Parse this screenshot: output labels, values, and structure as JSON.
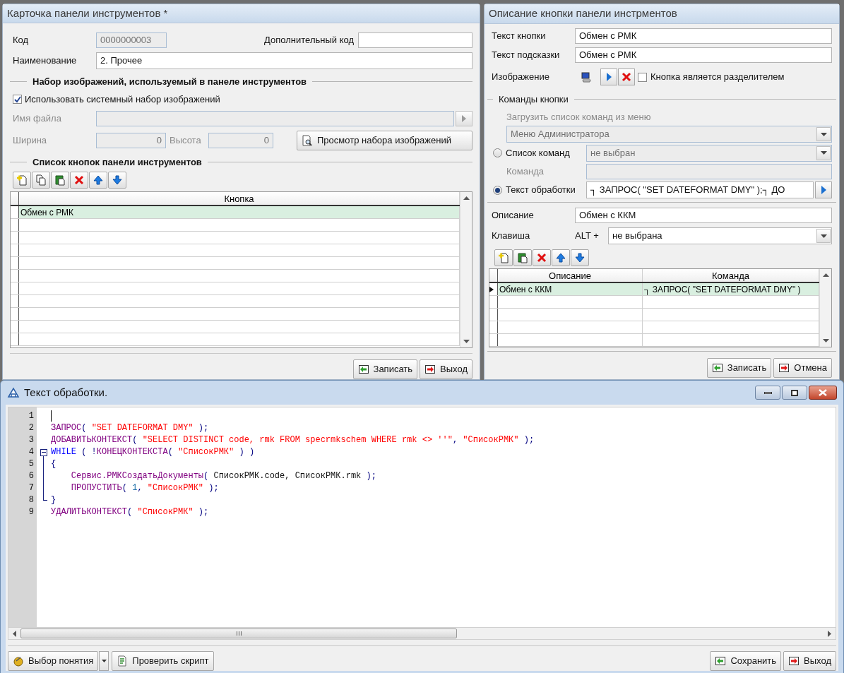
{
  "card": {
    "title": "Карточка панели инструментов *",
    "code": {
      "label": "Код",
      "value": "0000000003",
      "disabled": true
    },
    "extra_code": {
      "label": "Дополнительный код"
    },
    "name": {
      "label": "Наименование",
      "value": "2. Прочее"
    },
    "images": {
      "title": "Набор изображений, используемый в панеле инструментов",
      "use_system": {
        "label": "Использовать системный набор изображений",
        "checked": true
      },
      "file": {
        "label": "Имя файла",
        "disabled": true
      },
      "width": {
        "label": "Ширина",
        "value": "0",
        "disabled": true
      },
      "height": {
        "label": "Высота",
        "value": "0",
        "disabled": true
      },
      "preview": "Просмотр набора изображений"
    },
    "buttons_list": {
      "title": "Список кнопок панели инструментов",
      "table": {
        "columns": [
          "Кнопка"
        ],
        "rows": [
          {
            "cells": [
              "Обмен с РМК"
            ],
            "selected": true
          }
        ]
      }
    },
    "actions": [
      {
        "label": "Записать",
        "kind": "save"
      },
      {
        "label": "Выход",
        "kind": "exit"
      }
    ]
  },
  "button_card": {
    "title": "Описание кнопки панели инстрментов",
    "caption": {
      "label": "Текст кнопки",
      "value": "Обмен с РМК"
    },
    "tooltip": {
      "label": "Текст подсказки",
      "value": "Обмен с РМК"
    },
    "image": {
      "label": "Изображение"
    },
    "separator": {
      "label": "Кнопка является разделителем",
      "checked": false
    },
    "commands": {
      "title": "Команды кнопки",
      "menu_source": {
        "label": "Загрузить список команд из меню",
        "value": "Меню Администратора",
        "disabled": true
      },
      "command_list": {
        "label": "Список команд",
        "selected": false,
        "value": "не выбран",
        "disabled": true
      },
      "command": {
        "label": "Команда",
        "disabled": true
      },
      "script": {
        "label": "Текст обработки",
        "selected": true,
        "value": "┐ ЗАПРОС( \"SET DATEFORMAT DMY\" );┐ ДО"
      }
    },
    "description": {
      "label": "Описание",
      "value": "Обмен с ККМ"
    },
    "hotkey": {
      "label": "Клавиша",
      "modifier": "ALT +",
      "value": "не выбрана"
    },
    "table": {
      "columns": [
        "Описание",
        "Команда"
      ],
      "rows": [
        {
          "cells": [
            "Обмен с ККМ",
            "┐ ЗАПРОС( \"SET DATEFORMAT DMY\" )"
          ],
          "selected": true
        }
      ]
    },
    "actions": [
      {
        "label": "Записать",
        "kind": "save"
      },
      {
        "label": "Отмена",
        "kind": "exit"
      }
    ]
  },
  "script_window": {
    "title": "Текст обработки.",
    "lines": [
      {
        "number": "1",
        "kind": "line",
        "cursor": true
      },
      {
        "number": "2",
        "kind": "line",
        "segments": [
          {
            "kind": "function",
            "text": "ЗАПРОС"
          },
          {
            "kind": "punct",
            "text": "( "
          },
          {
            "kind": "string",
            "text": "\"SET DATEFORMAT DMY\""
          },
          {
            "kind": "punct",
            "text": " );"
          }
        ]
      },
      {
        "number": "3",
        "kind": "line",
        "segments": [
          {
            "kind": "function",
            "text": "ДОБАВИТЬКОНТЕКСТ"
          },
          {
            "kind": "punct",
            "text": "( "
          },
          {
            "kind": "string",
            "text": "\"SELECT DISTINCT code, rmk FROM specrmkschem WHERE rmk <> ''\""
          },
          {
            "kind": "punct",
            "text": ", "
          },
          {
            "kind": "string",
            "text": "\"СписокРМК\""
          },
          {
            "kind": "punct",
            "text": " );"
          }
        ]
      },
      {
        "number": "4",
        "kind": "fold_start",
        "segments": [
          {
            "kind": "keyword",
            "text": "WHILE"
          },
          {
            "kind": "punct",
            "text": " ( !"
          },
          {
            "kind": "function",
            "text": "КОНЕЦКОНТЕКСТА"
          },
          {
            "kind": "punct",
            "text": "( "
          },
          {
            "kind": "string",
            "text": "\"СписокРМК\""
          },
          {
            "kind": "punct",
            "text": " ) )"
          }
        ]
      },
      {
        "number": "5",
        "kind": "fold_body",
        "segments": [
          {
            "kind": "punct",
            "text": "{"
          }
        ]
      },
      {
        "number": "6",
        "kind": "fold_body",
        "segments": [
          {
            "kind": "function",
            "text": "    Сервис.РМКСоздатьДокументы"
          },
          {
            "kind": "punct",
            "text": "( "
          },
          {
            "kind": "plain",
            "text": "СписокРМК.code, СписокРМК.rmk"
          },
          {
            "kind": "punct",
            "text": " );"
          }
        ]
      },
      {
        "number": "7",
        "kind": "fold_body",
        "segments": [
          {
            "kind": "function",
            "text": "    ПРОПУСТИТЬ"
          },
          {
            "kind": "punct",
            "text": "( "
          },
          {
            "kind": "number",
            "text": "1"
          },
          {
            "kind": "punct",
            "text": ", "
          },
          {
            "kind": "string",
            "text": "\"СписокРМК\""
          },
          {
            "kind": "punct",
            "text": " );"
          }
        ]
      },
      {
        "number": "8",
        "kind": "fold_end",
        "segments": [
          {
            "kind": "punct",
            "text": "}"
          }
        ]
      },
      {
        "number": "9",
        "kind": "line",
        "segments": [
          {
            "kind": "function",
            "text": "УДАЛИТЬКОНТЕКСТ"
          },
          {
            "kind": "punct",
            "text": "( "
          },
          {
            "kind": "string",
            "text": "\"СписокРМК\""
          },
          {
            "kind": "punct",
            "text": " );"
          }
        ]
      }
    ],
    "actions_left": [
      {
        "label": "Выбор понятия",
        "kind": "concept"
      },
      {
        "label": "Проверить скрипт",
        "kind": "check"
      }
    ],
    "actions_right": [
      {
        "label": "Сохранить",
        "kind": "save"
      },
      {
        "label": "Выход",
        "kind": "exit"
      }
    ]
  }
}
